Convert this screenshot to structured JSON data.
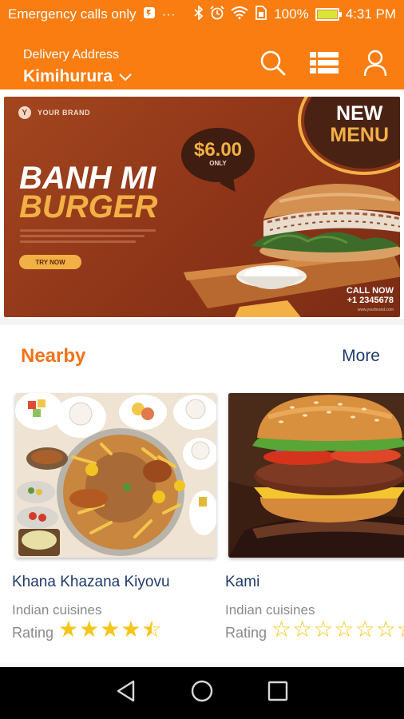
{
  "status_bar": {
    "carrier": "Emergency calls only",
    "dots": "···",
    "battery_percent": "100%",
    "battery_level": 1.0,
    "time": "4:31 PM"
  },
  "header": {
    "delivery_label": "Delivery Address",
    "city": "Kimihurura",
    "icons": [
      "search-icon",
      "list-view-icon",
      "profile-icon"
    ]
  },
  "banner": {
    "brand": "YOUR BRAND",
    "brand_logo_letter": "Y",
    "badge_line1": "NEW",
    "badge_line2": "MENU",
    "price": "$6.00",
    "price_note": "ONLY",
    "title_line1": "BANH MI",
    "title_line2": "BURGER",
    "cta": "TRY NOW",
    "call_label": "CALL NOW",
    "phone": "+1 2345678",
    "website": "www.yourbrand.com",
    "colors": {
      "background": "#8d3418",
      "accent": "#f2b045"
    }
  },
  "nearby": {
    "title": "Nearby",
    "more_label": "More",
    "restaurants": [
      {
        "name": "Khana Khazana Kiyovu",
        "cuisine": "Indian cuisines",
        "rating_label": "Rating",
        "rating": 4.5,
        "max_rating": 5
      },
      {
        "name": "Kami",
        "cuisine": "Indian cuisines",
        "rating_label": "Rating",
        "rating": 0,
        "max_rating": 7
      }
    ]
  },
  "nav": {
    "icons": [
      "back-icon",
      "home-icon",
      "recents-icon"
    ]
  },
  "colors": {
    "brand_orange": "#f97d10",
    "section_title": "#f0731a",
    "link_blue": "#1f3a6b",
    "star_gold": "#f5c518"
  }
}
